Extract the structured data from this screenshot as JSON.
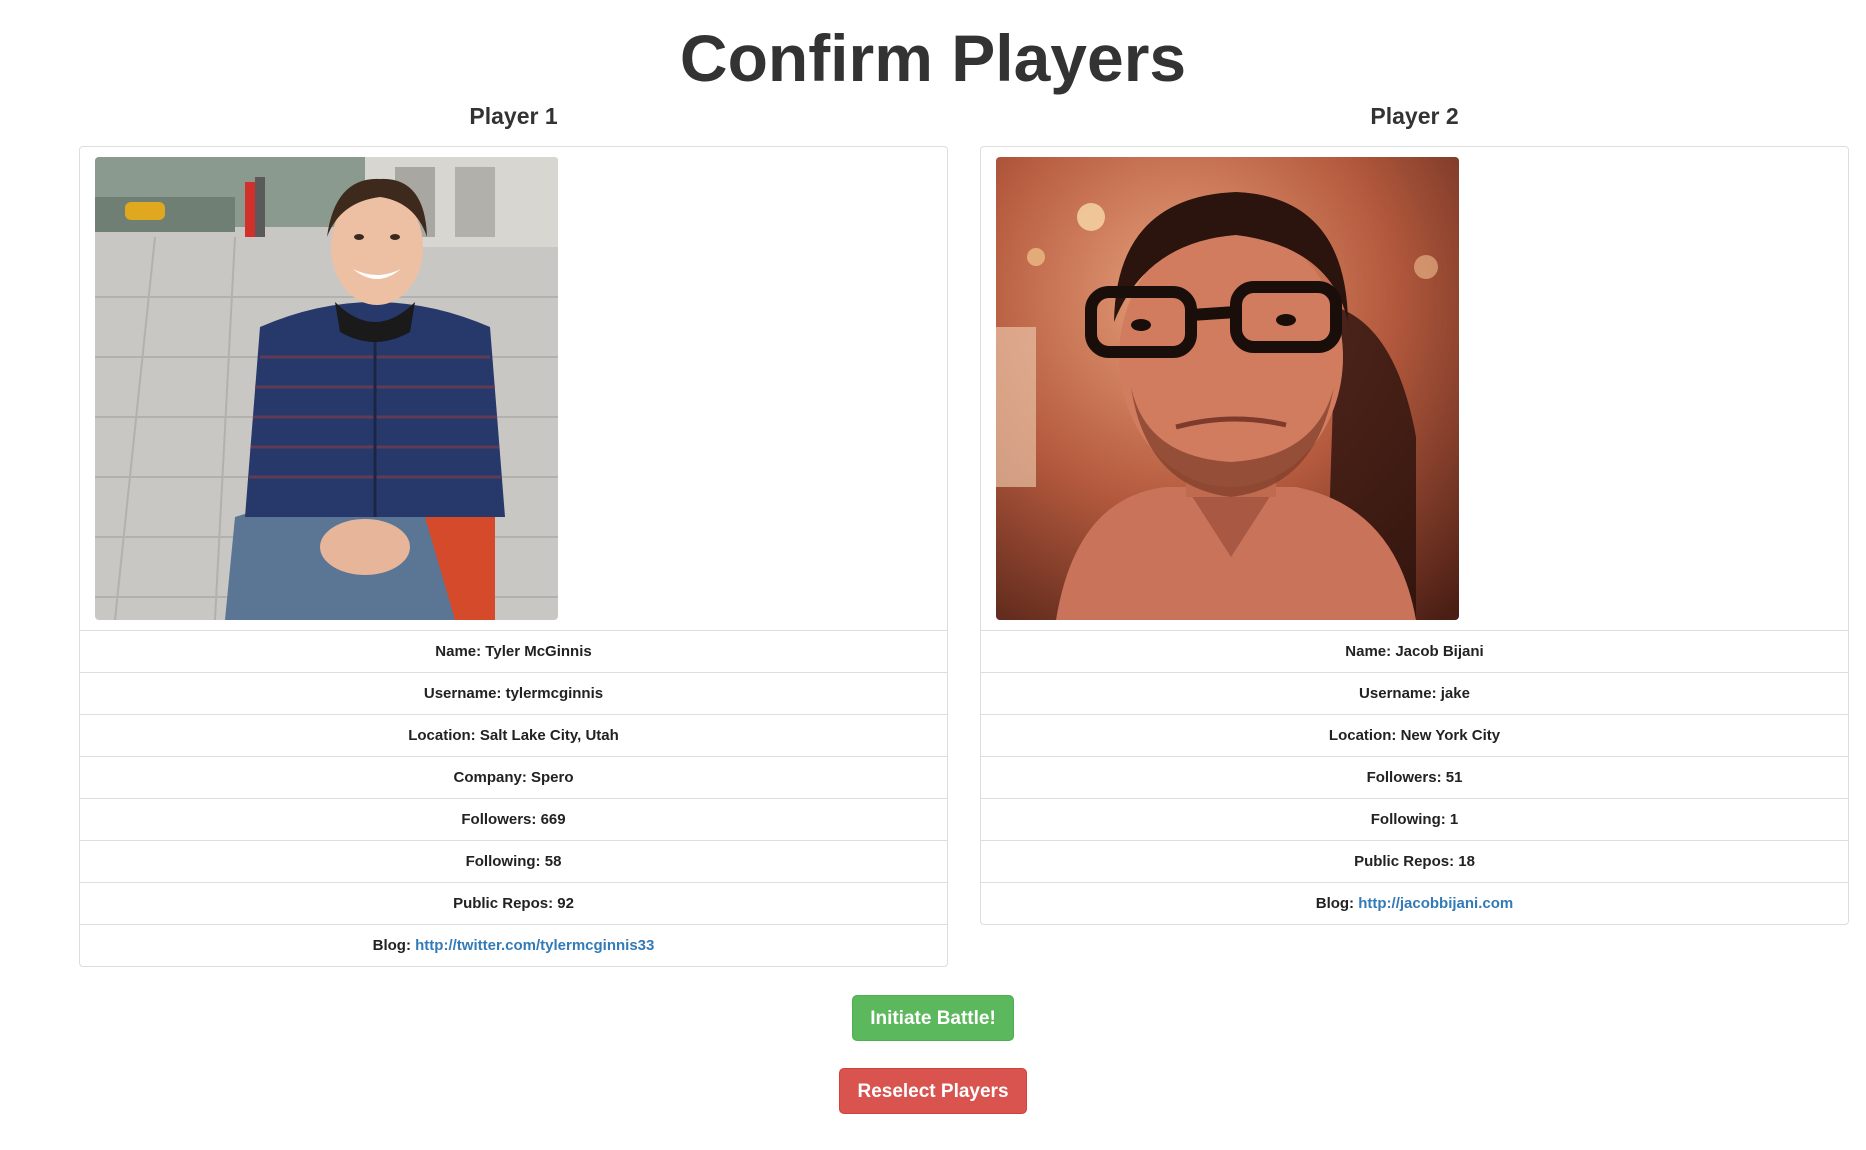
{
  "page": {
    "title": "Confirm Players"
  },
  "players": [
    {
      "heading": "Player 1",
      "avatar_icon": "avatar-photo",
      "rows": [
        {
          "label": "Name: ",
          "value": "Tyler McGinnis"
        },
        {
          "label": "Username: ",
          "value": "tylermcginnis"
        },
        {
          "label": "Location: ",
          "value": "Salt Lake City, Utah"
        },
        {
          "label": "Company: ",
          "value": "Spero"
        },
        {
          "label": "Followers: ",
          "value": "669"
        },
        {
          "label": "Following: ",
          "value": "58"
        },
        {
          "label": "Public Repos: ",
          "value": "92"
        }
      ],
      "blog": {
        "label": "Blog: ",
        "url": "http://twitter.com/tylermcginnis33"
      }
    },
    {
      "heading": "Player 2",
      "avatar_icon": "avatar-photo",
      "rows": [
        {
          "label": "Name: ",
          "value": "Jacob Bijani"
        },
        {
          "label": "Username: ",
          "value": "jake"
        },
        {
          "label": "Location: ",
          "value": "New York City"
        },
        {
          "label": "Followers: ",
          "value": "51"
        },
        {
          "label": "Following: ",
          "value": "1"
        },
        {
          "label": "Public Repos: ",
          "value": "18"
        }
      ],
      "blog": {
        "label": "Blog: ",
        "url": "http://jacobbijani.com"
      }
    }
  ],
  "actions": {
    "initiate_label": "Initiate Battle!",
    "reselect_label": "Reselect Players"
  },
  "colors": {
    "success": "#5cb85c",
    "danger": "#d9534f",
    "link": "#337ab7",
    "border": "#dddddd"
  }
}
